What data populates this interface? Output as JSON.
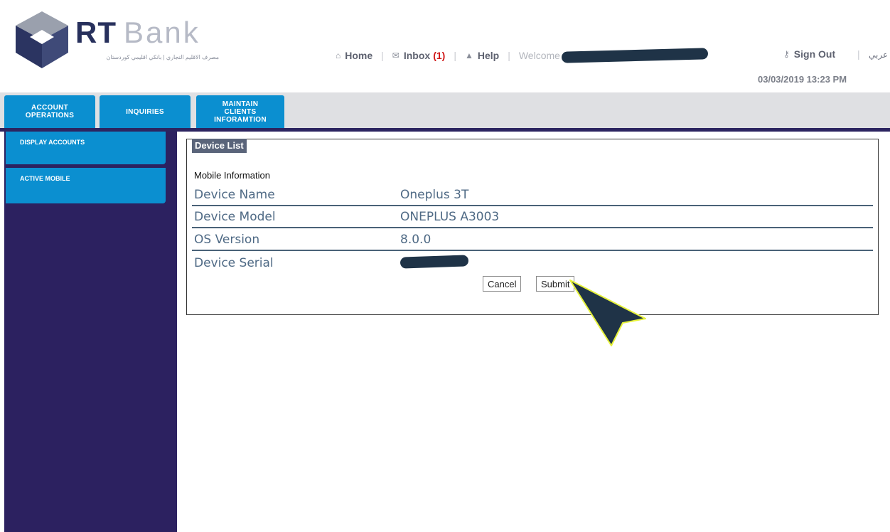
{
  "header": {
    "brand_primary": "RT",
    "brand_secondary": "Bank",
    "brand_tagline": "مصرف الاقليم التجاري | بانكي اقليمي كوردستان",
    "nav": {
      "home": "Home",
      "inbox": "Inbox",
      "inbox_count": "(1)",
      "help": "Help",
      "welcome": "Welcome",
      "sign_out": "Sign Out",
      "language": "عربي"
    },
    "datetime": "03/03/2019 13:23 PM"
  },
  "tabs": [
    {
      "label_line1": "ACCOUNT",
      "label_line2": "OPERATIONS",
      "label_line3": ""
    },
    {
      "label_line1": "INQUIRIES",
      "label_line2": "",
      "label_line3": ""
    },
    {
      "label_line1": "MAINTAIN",
      "label_line2": "CLIENTS",
      "label_line3": "INFORAMTION"
    }
  ],
  "sidebar": {
    "items": [
      {
        "label": "DISPLAY ACCOUNTS"
      },
      {
        "label": "ACTIVE MOBILE"
      }
    ]
  },
  "device_list": {
    "legend": "Device List",
    "section_title": "Mobile Information",
    "rows": [
      {
        "label": "Device Name",
        "value": "Oneplus 3T"
      },
      {
        "label": "Device Model",
        "value": "ONEPLUS A3003"
      },
      {
        "label": "OS Version",
        "value": "8.0.0"
      },
      {
        "label": "Device Serial",
        "value": ""
      }
    ],
    "cancel_label": "Cancel",
    "submit_label": "Submit"
  },
  "colors": {
    "brand_navy": "#2c2160",
    "tab_blue": "#0b8fd0",
    "label_blue": "#4f6a85",
    "legend_bg": "#5a647a",
    "inbox_count_red": "#d01818",
    "annotation_arrow": "#1f3347",
    "annotation_glow": "#e6f23a"
  },
  "icons": {
    "home": "home-icon",
    "inbox": "envelope-icon",
    "help": "warning-triangle-icon",
    "sign_out": "key-icon",
    "logo": "cube-logo-icon",
    "annotation": "arrow-pointer-icon"
  }
}
